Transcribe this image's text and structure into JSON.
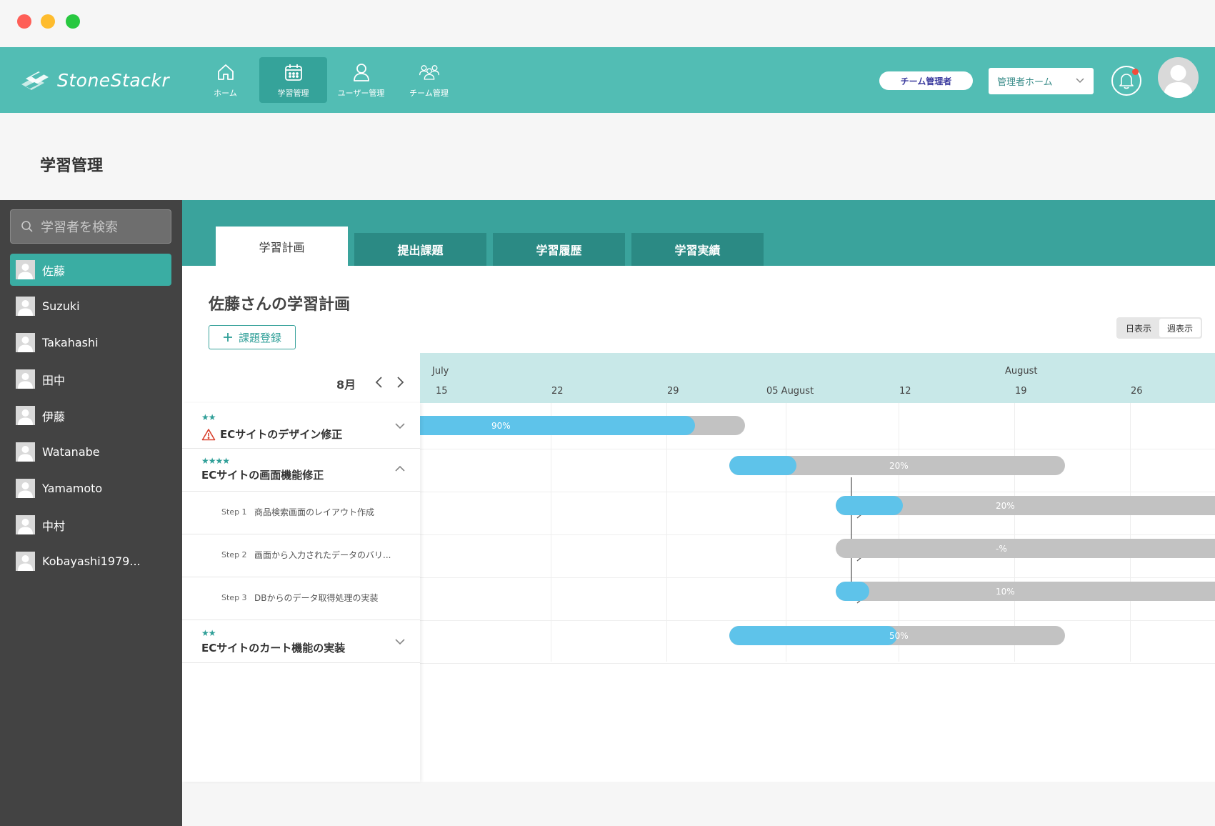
{
  "app": {
    "name": "StoneStackr",
    "colors": {
      "header": "#52bdb4",
      "accent": "#3aa39c",
      "progress": "#5ec3ea",
      "track": "#c2c2c2",
      "sidebar": "#434343"
    }
  },
  "nav": {
    "items": [
      {
        "label": "ホーム",
        "icon": "home-icon",
        "active": false
      },
      {
        "label": "学習管理",
        "icon": "calendar-icon",
        "active": true
      },
      {
        "label": "ユーザー管理",
        "icon": "user-icon",
        "active": false
      },
      {
        "label": "チーム管理",
        "icon": "team-icon",
        "active": false
      }
    ]
  },
  "header": {
    "role_badge": "チーム管理者",
    "mode_select": {
      "value": "管理者ホーム"
    },
    "notification_icon": "bell-icon",
    "avatar_icon": "user-avatar-icon"
  },
  "page": {
    "title": "学習管理"
  },
  "sidebar": {
    "search": {
      "placeholder": "学習者を検索"
    },
    "learners": [
      {
        "name": "佐藤",
        "active": true
      },
      {
        "name": "Suzuki",
        "active": false
      },
      {
        "name": "Takahashi",
        "active": false
      },
      {
        "name": "田中",
        "active": false
      },
      {
        "name": "伊藤",
        "active": false
      },
      {
        "name": "Watanabe",
        "active": false
      },
      {
        "name": "Yamamoto",
        "active": false
      },
      {
        "name": "中村",
        "active": false
      },
      {
        "name": "Kobayashi1979...",
        "active": false
      }
    ]
  },
  "tabs": [
    {
      "label": "学習計画",
      "active": true
    },
    {
      "label": "提出課題",
      "active": false
    },
    {
      "label": "学習履歴",
      "active": false
    },
    {
      "label": "学習実績",
      "active": false
    }
  ],
  "plan": {
    "title": "佐藤さんの学習計画",
    "add_button": "課題登録",
    "view_toggle": {
      "day": "日表示",
      "week": "週表示",
      "selected": "week"
    },
    "month_label": "8月"
  },
  "timeline": {
    "months": [
      "July",
      "August"
    ],
    "days": [
      "15",
      "22",
      "29",
      "05 August",
      "12",
      "19",
      "26"
    ]
  },
  "tasks": [
    {
      "stars": "★★",
      "name": "ECサイトのデザイン修正",
      "warning": true,
      "expanded": false,
      "progress": 0.9,
      "pct_label": "90%"
    },
    {
      "stars": "★★★★",
      "name": "ECサイトの画面機能修正",
      "warning": false,
      "expanded": true,
      "progress": 0.2,
      "pct_label": "20%",
      "steps": [
        {
          "label": "Step 1",
          "name": "商品検索画面のレイアウト作成",
          "progress": 0.2,
          "pct_label": "20%"
        },
        {
          "label": "Step 2",
          "name": "画面から入力されたデータのバリ...",
          "progress": 0,
          "pct_label": "-%"
        },
        {
          "label": "Step 3",
          "name": "DBからのデータ取得処理の実装",
          "progress": 0.1,
          "pct_label": "10%"
        }
      ]
    },
    {
      "stars": "★★",
      "name": "ECサイトのカート機能の実装",
      "warning": false,
      "expanded": false,
      "progress": 0.5,
      "pct_label": "50%"
    }
  ]
}
